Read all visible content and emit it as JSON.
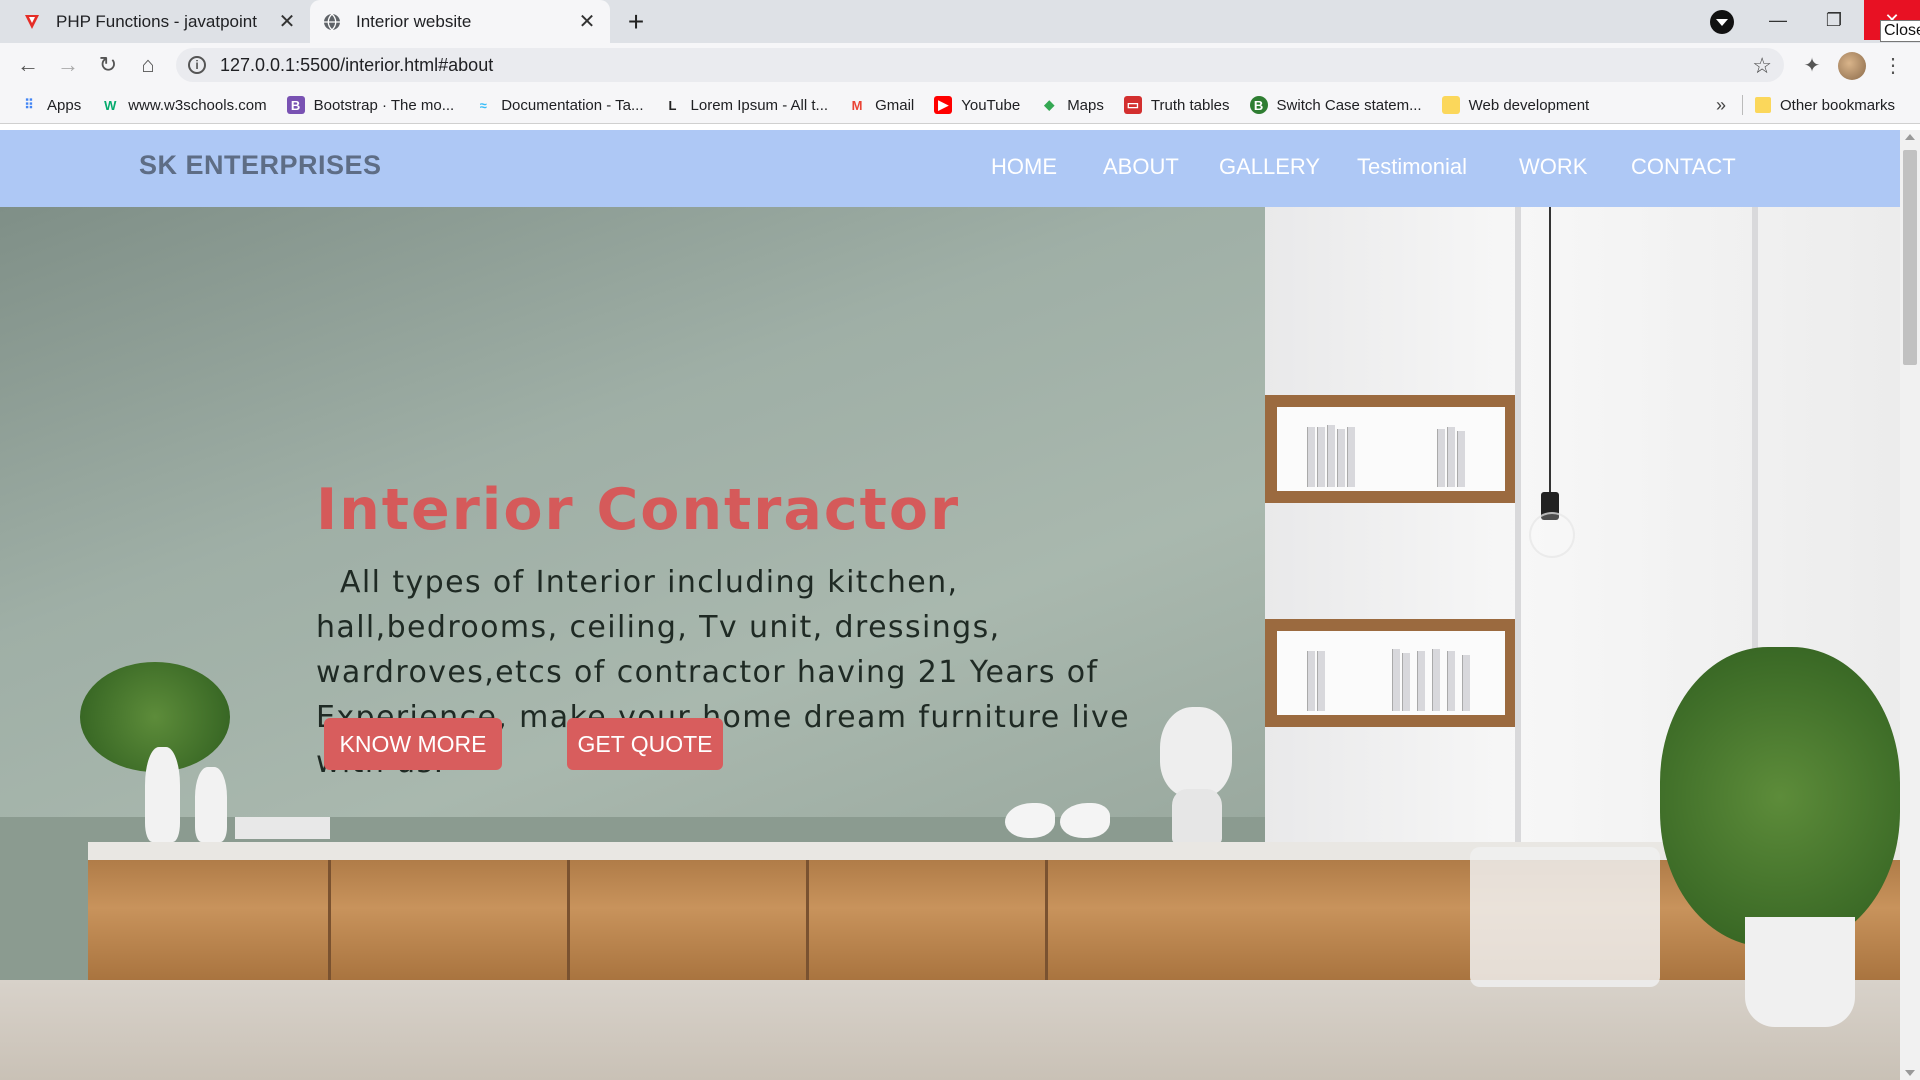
{
  "browser": {
    "tabs": [
      {
        "title": "PHP Functions - javatpoint",
        "favicon": "javatpoint-icon",
        "active": false
      },
      {
        "title": "Interior website",
        "favicon": "globe-icon",
        "active": true
      }
    ],
    "new_tab_symbol": "+",
    "url": "127.0.0.1:5500/interior.html#about",
    "close_tooltip": "Close",
    "bookmarks": [
      {
        "label": "Apps",
        "icon": "apps-grid-icon",
        "color": "#4285f4"
      },
      {
        "label": "www.w3schools.com",
        "icon": "w3schools-icon",
        "color": "#04aa6d"
      },
      {
        "label": "Bootstrap · The mo...",
        "icon": "bootstrap-icon",
        "color": "#7952b3"
      },
      {
        "label": "Documentation - Ta...",
        "icon": "tailwind-icon",
        "color": "#38bdf8"
      },
      {
        "label": "Lorem Ipsum - All t...",
        "icon": "lorem-icon",
        "color": "#222222"
      },
      {
        "label": "Gmail",
        "icon": "gmail-icon",
        "color": "#ea4335"
      },
      {
        "label": "YouTube",
        "icon": "youtube-icon",
        "color": "#ff0000"
      },
      {
        "label": "Maps",
        "icon": "maps-icon",
        "color": "#34a853"
      },
      {
        "label": "Truth tables",
        "icon": "truth-tables-icon",
        "color": "#d32f2f"
      },
      {
        "label": "Switch Case statem...",
        "icon": "switch-case-icon",
        "color": "#2e7d32"
      },
      {
        "label": "Web development",
        "icon": "folder-icon",
        "color": "#fbd75b"
      }
    ],
    "bookmarks_overflow": "»",
    "other_bookmarks": "Other bookmarks"
  },
  "site": {
    "brand": "SK ENTERPRISES",
    "nav": [
      "HOME",
      "ABOUT",
      "GALLERY",
      "Testimonial",
      "WORK",
      "CONTACT"
    ],
    "hero_title": "Interior Contractor",
    "hero_text": "All types of Interior including kitchen, hall,bedrooms, ceiling, Tv unit, dressings, wardroves,etcs of contractor having 21 Years of Experience, make your home dream furniture live with us.",
    "buttons": {
      "know_more": "KNOW MORE",
      "get_quote": "GET QUOTE"
    }
  },
  "colors": {
    "navbar_bg": "#aec8f5",
    "brand_text": "#5e6d85",
    "accent_red": "#d55a5a",
    "close_button": "#e81123"
  }
}
